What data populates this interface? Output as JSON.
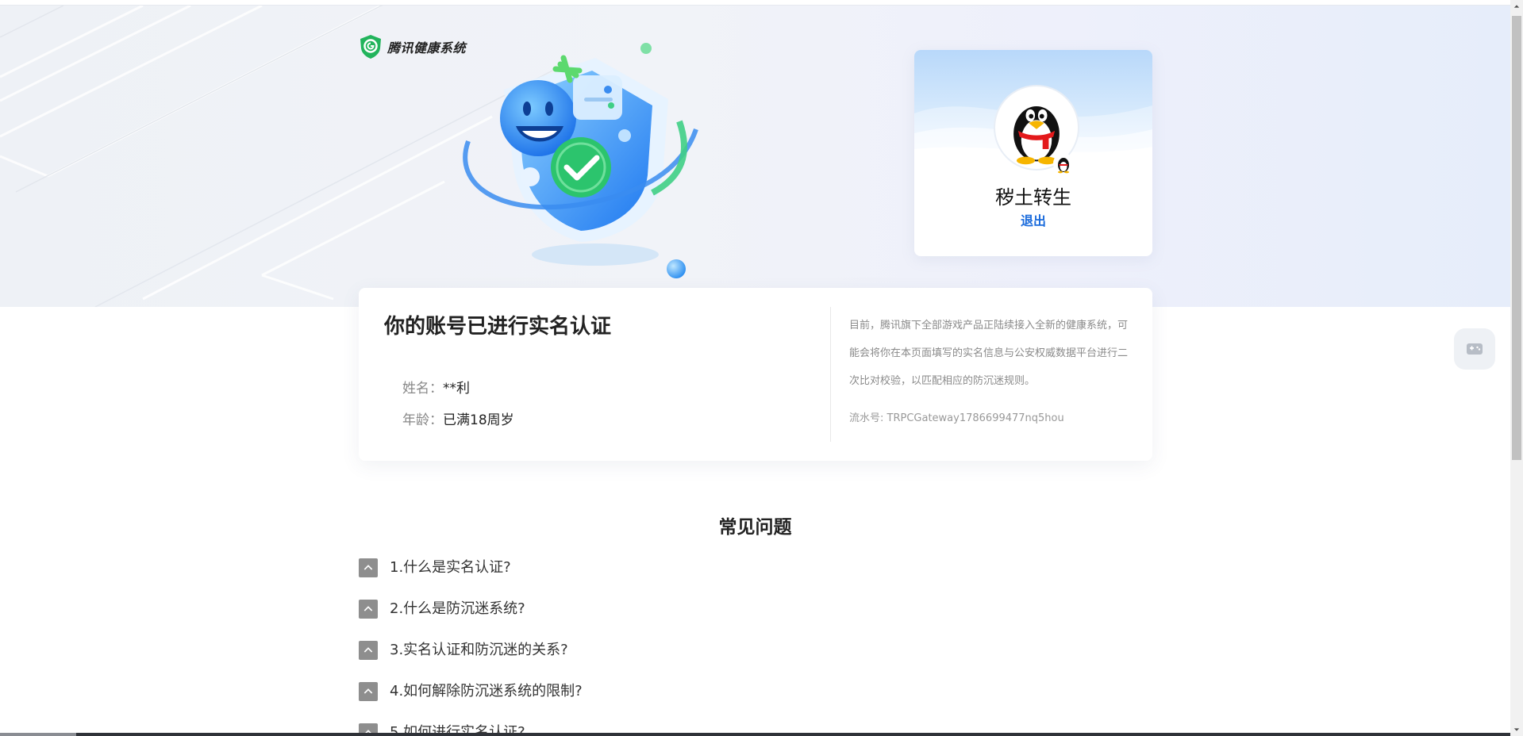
{
  "brand": {
    "name": "腾讯健康系统"
  },
  "user": {
    "name": "秽土转生",
    "logout_label": "退出"
  },
  "verification": {
    "title": "你的账号已进行实名认证",
    "fields": [
      {
        "label": "姓名：",
        "value": "**利"
      },
      {
        "label": "年龄：",
        "value": "已满18周岁"
      }
    ],
    "description": "目前，腾讯旗下全部游戏产品正陆续接入全新的健康系统，可能会将你在本页面填写的实名信息与公安权威数据平台进行二次比对校验，以匹配相应的防沉迷规则。",
    "serial_label": "流水号: ",
    "serial_value": "TRPCGateway1786699477nq5hou"
  },
  "faq": {
    "title": "常见问题",
    "items": [
      {
        "question": "1.什么是实名认证?"
      },
      {
        "question": "2.什么是防沉迷系统?"
      },
      {
        "question": "3.实名认证和防沉迷的关系?"
      },
      {
        "question": "4.如何解除防沉迷系统的限制?"
      },
      {
        "question": "5.如何进行实名认证?"
      }
    ]
  },
  "icons": {
    "logo": "tencent-health-shield-icon",
    "faq_toggle": "chevron-up-icon",
    "float_button": "game-controller-icon"
  },
  "colors": {
    "link": "#1a6bdc",
    "brand_green": "#22b45c",
    "toggle_bg": "#8e8e8e"
  }
}
